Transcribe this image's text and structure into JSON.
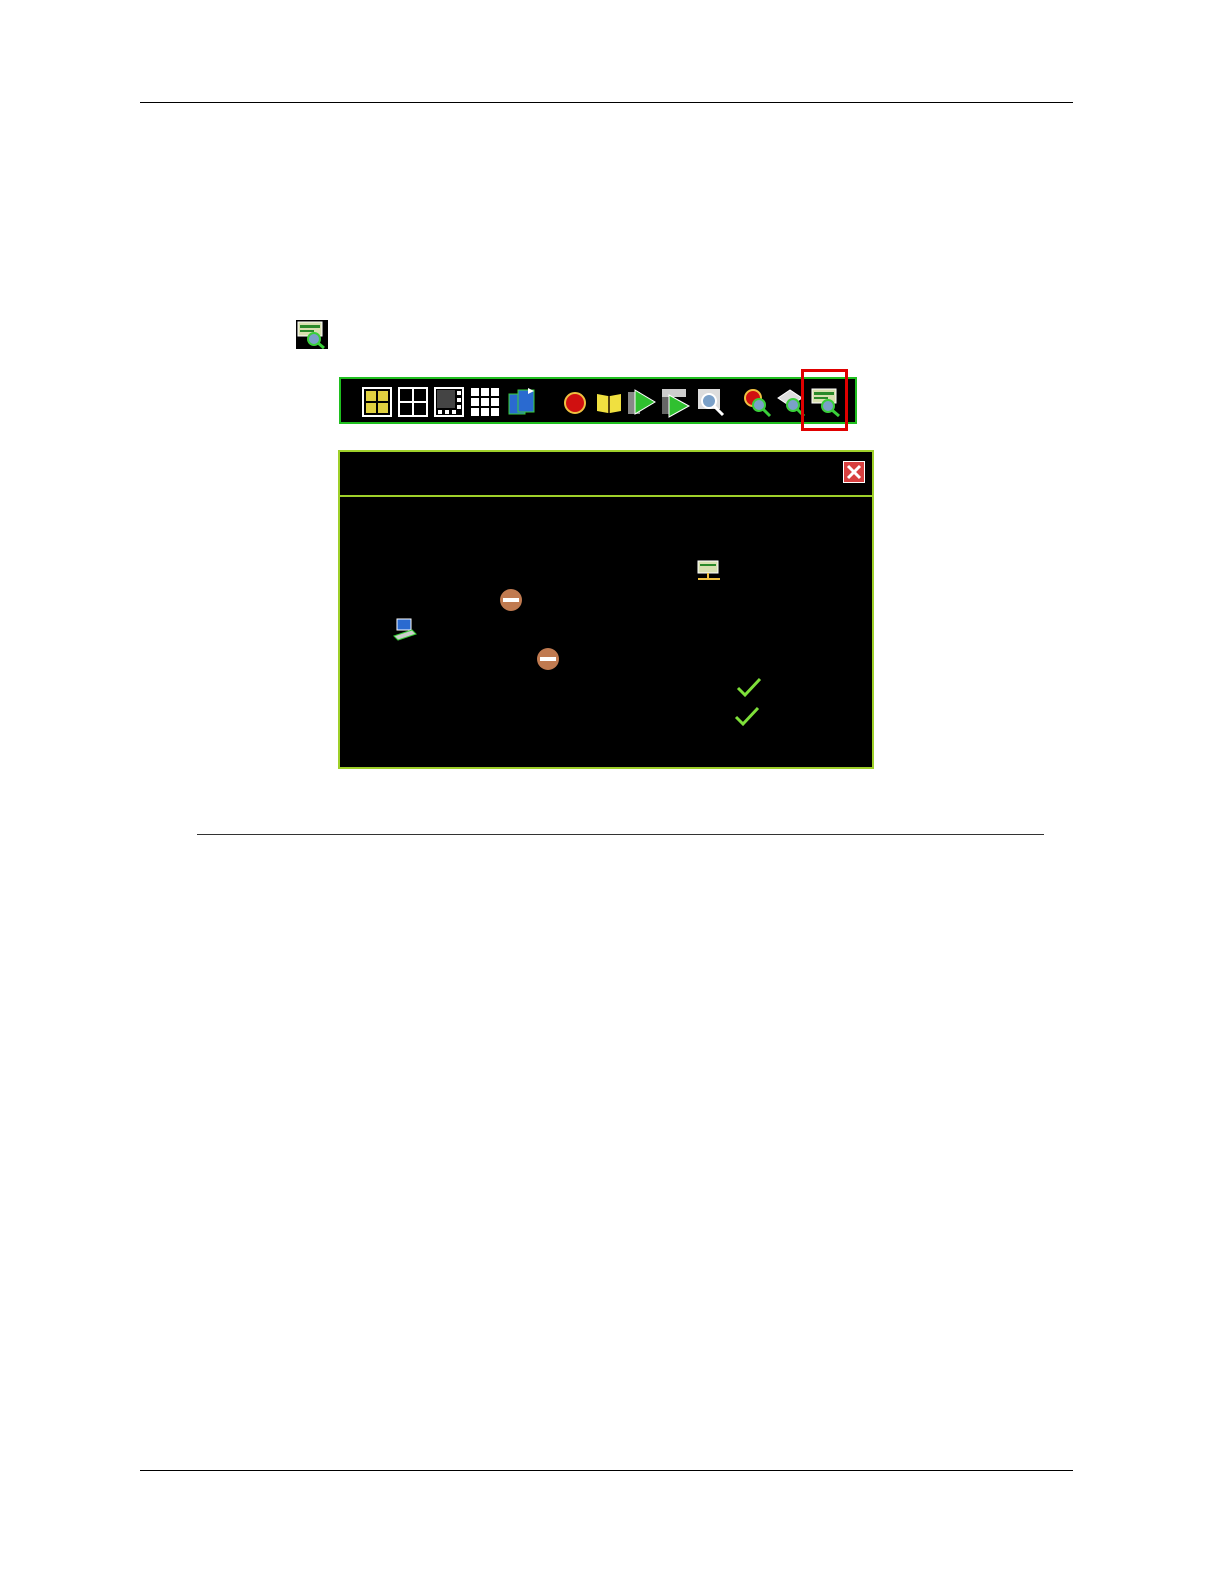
{
  "document": {
    "icons": {
      "inline": "search-log-icon",
      "close": "close-icon",
      "network": "network-server-icon",
      "computer": "computer-icon",
      "status_off_1": "disabled-status-icon",
      "status_off_2": "disabled-status-icon",
      "check_1": "checkmark-icon",
      "check_2": "checkmark-icon"
    }
  },
  "toolbar": {
    "buttons": [
      "quad-numbered-view-icon",
      "quad-view-icon",
      "picture-in-picture-view-icon",
      "nine-split-view-icon",
      "channel-sequence-icon",
      "record-icon",
      "book-icon",
      "playback-icon",
      "timed-playback-icon",
      "search-icon",
      "record-search-icon",
      "event-search-icon",
      "log-search-icon"
    ],
    "highlighted": "log-search-icon"
  },
  "colors": {
    "toolbar_border": "#1fbf1f",
    "dialog_border": "#9fd02a",
    "highlight": "#e00000",
    "close_button": "#d84040"
  }
}
